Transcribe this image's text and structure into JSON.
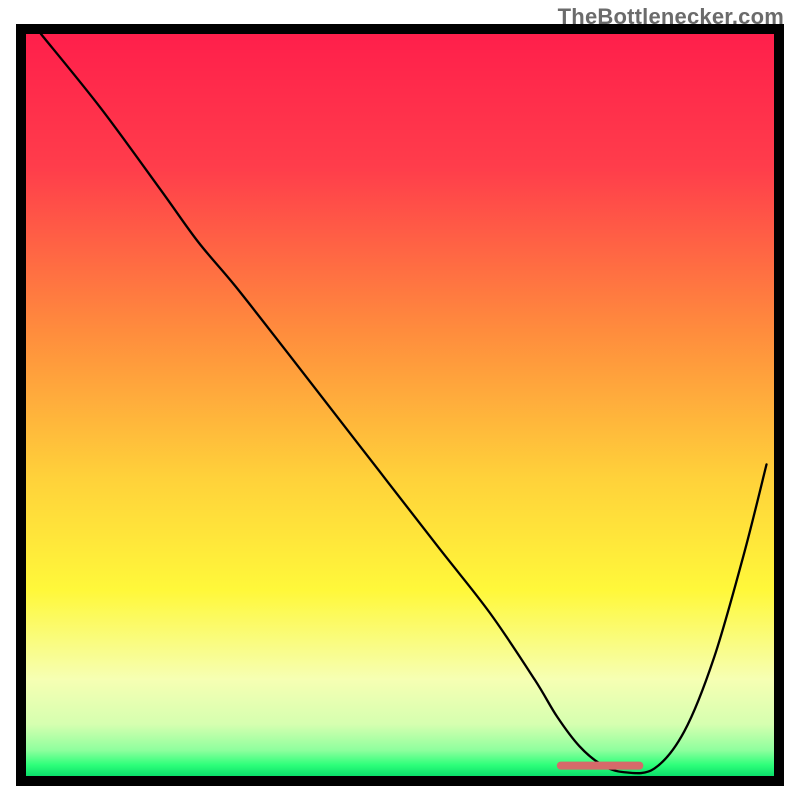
{
  "watermark": "TheBottlenecker.com",
  "chart_data": {
    "type": "line",
    "title": "",
    "xlabel": "",
    "ylabel": "",
    "xlim": [
      0,
      100
    ],
    "ylim": [
      0,
      100
    ],
    "grid": false,
    "gradient_stops": [
      {
        "offset": 0,
        "color": "#ff1f4b"
      },
      {
        "offset": 18,
        "color": "#ff3d4b"
      },
      {
        "offset": 40,
        "color": "#ff8c3d"
      },
      {
        "offset": 60,
        "color": "#ffd23a"
      },
      {
        "offset": 75,
        "color": "#fff83a"
      },
      {
        "offset": 87,
        "color": "#f6ffb3"
      },
      {
        "offset": 93,
        "color": "#d6ffb0"
      },
      {
        "offset": 96.5,
        "color": "#8fff9e"
      },
      {
        "offset": 98.5,
        "color": "#2eff7a"
      },
      {
        "offset": 100,
        "color": "#0adf6a"
      }
    ],
    "series": [
      {
        "name": "curve",
        "color": "#000000",
        "width": 2.3,
        "x": [
          2,
          10,
          18,
          23,
          28,
          35,
          45,
          55,
          62,
          68,
          71,
          74,
          77,
          80,
          84,
          88,
          92,
          96,
          99
        ],
        "y": [
          100,
          90,
          79,
          72,
          66,
          57,
          44,
          31,
          22,
          13,
          8,
          4,
          1.5,
          0.5,
          1,
          6,
          16,
          30,
          42
        ]
      }
    ],
    "flat_segment": {
      "color": "#d66a6a",
      "x_start": 71.5,
      "x_end": 82,
      "y": 1.4,
      "thickness": 8
    },
    "frame": {
      "color": "#000000",
      "width": 10
    }
  }
}
